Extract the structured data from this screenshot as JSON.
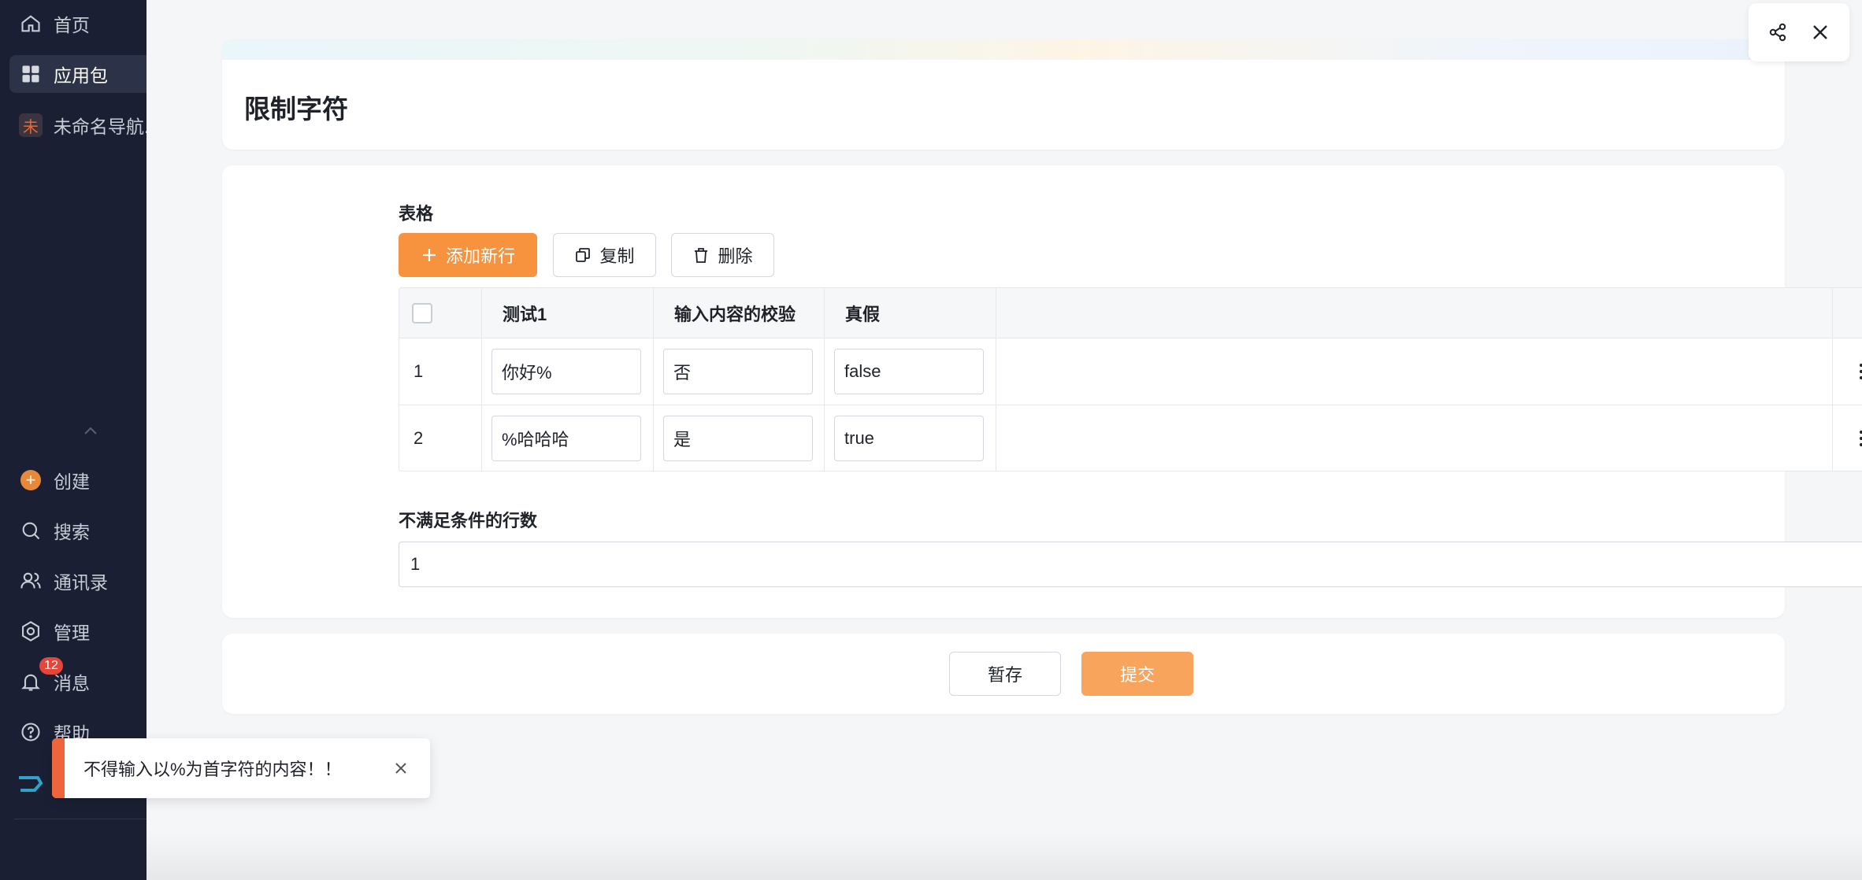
{
  "sidebar": {
    "items": [
      {
        "label": "首页",
        "icon": "home-icon"
      },
      {
        "label": "应用包",
        "icon": "apps-grid-icon"
      },
      {
        "label": "未命名导航...",
        "badge": "未"
      }
    ],
    "bottom_items": [
      {
        "label": "创建",
        "icon": "plus-circle-icon"
      },
      {
        "label": "搜索",
        "icon": "search-icon"
      },
      {
        "label": "通讯录",
        "icon": "contacts-icon"
      },
      {
        "label": "管理",
        "icon": "settings-icon"
      },
      {
        "label": "消息",
        "icon": "bell-icon",
        "badge": "12"
      },
      {
        "label": "帮助",
        "icon": "help-icon"
      }
    ]
  },
  "page": {
    "title": "限制字符"
  },
  "table_section": {
    "label": "表格",
    "add_row_label": "添加新行",
    "copy_label": "复制",
    "delete_label": "删除",
    "columns": [
      "测试1",
      "输入内容的校验",
      "真假"
    ],
    "rows": [
      {
        "index": "1",
        "test1": "你好%",
        "check": "否",
        "bool": "false"
      },
      {
        "index": "2",
        "test1": "%哈哈哈",
        "check": "是",
        "bool": "true"
      }
    ]
  },
  "count_field": {
    "label": "不满足条件的行数",
    "value": "1"
  },
  "footer": {
    "save_draft_label": "暂存",
    "submit_label": "提交"
  },
  "toast": {
    "message": "不得输入以%为首字符的内容！！"
  },
  "colors": {
    "primary": "#f7933e",
    "sidebar_bg": "#1a1f33",
    "toast_error": "#f0643b"
  }
}
